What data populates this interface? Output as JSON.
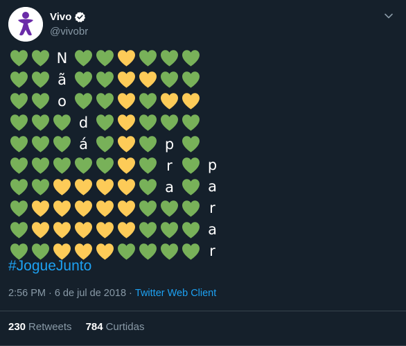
{
  "tweet": {
    "author": {
      "display_name": "Vivo",
      "handle": "@vivobr",
      "avatar_color": "#6a2ba8",
      "verified": true
    },
    "heart_colors": {
      "G": "#78b159",
      "Y": "#fdcb58"
    },
    "grid_rows": [
      [
        "G",
        "G",
        "N",
        "G",
        "G",
        "Y",
        "G",
        "G",
        "G"
      ],
      [
        "G",
        "G",
        "ã",
        "G",
        "G",
        "Y",
        "Y",
        "G",
        "G"
      ],
      [
        "G",
        "G",
        "o",
        "G",
        "G",
        "Y",
        "G",
        "Y",
        "Y"
      ],
      [
        "G",
        "G",
        "G",
        "d",
        "G",
        "Y",
        "G",
        "G",
        "G"
      ],
      [
        "G",
        "G",
        "G",
        "á",
        "G",
        "Y",
        "G",
        "p",
        "G"
      ],
      [
        "G",
        "G",
        "G",
        "G",
        "G",
        "Y",
        "G",
        "r",
        "G"
      ],
      [
        "G",
        "G",
        "Y",
        "Y",
        "Y",
        "Y",
        "G",
        "a",
        "G"
      ],
      [
        "G",
        "Y",
        "Y",
        "Y",
        "Y",
        "Y",
        "G",
        "G",
        "G"
      ],
      [
        "G",
        "Y",
        "Y",
        "Y",
        "Y",
        "Y",
        "G",
        "G",
        "G"
      ],
      [
        "G",
        "G",
        "Y",
        "Y",
        "Y",
        "G",
        "G",
        "G",
        "G"
      ]
    ],
    "side_letters": [
      "p",
      "a",
      "r",
      "a",
      "r"
    ],
    "hashtag": "#JogueJunto",
    "time": "2:56 PM",
    "date": "6 de jul de 2018",
    "separator": "·",
    "client": "Twitter Web Client",
    "stats": {
      "retweets_count": "230",
      "retweets_label": "Retweets",
      "likes_count": "784",
      "likes_label": "Curtidas"
    }
  }
}
